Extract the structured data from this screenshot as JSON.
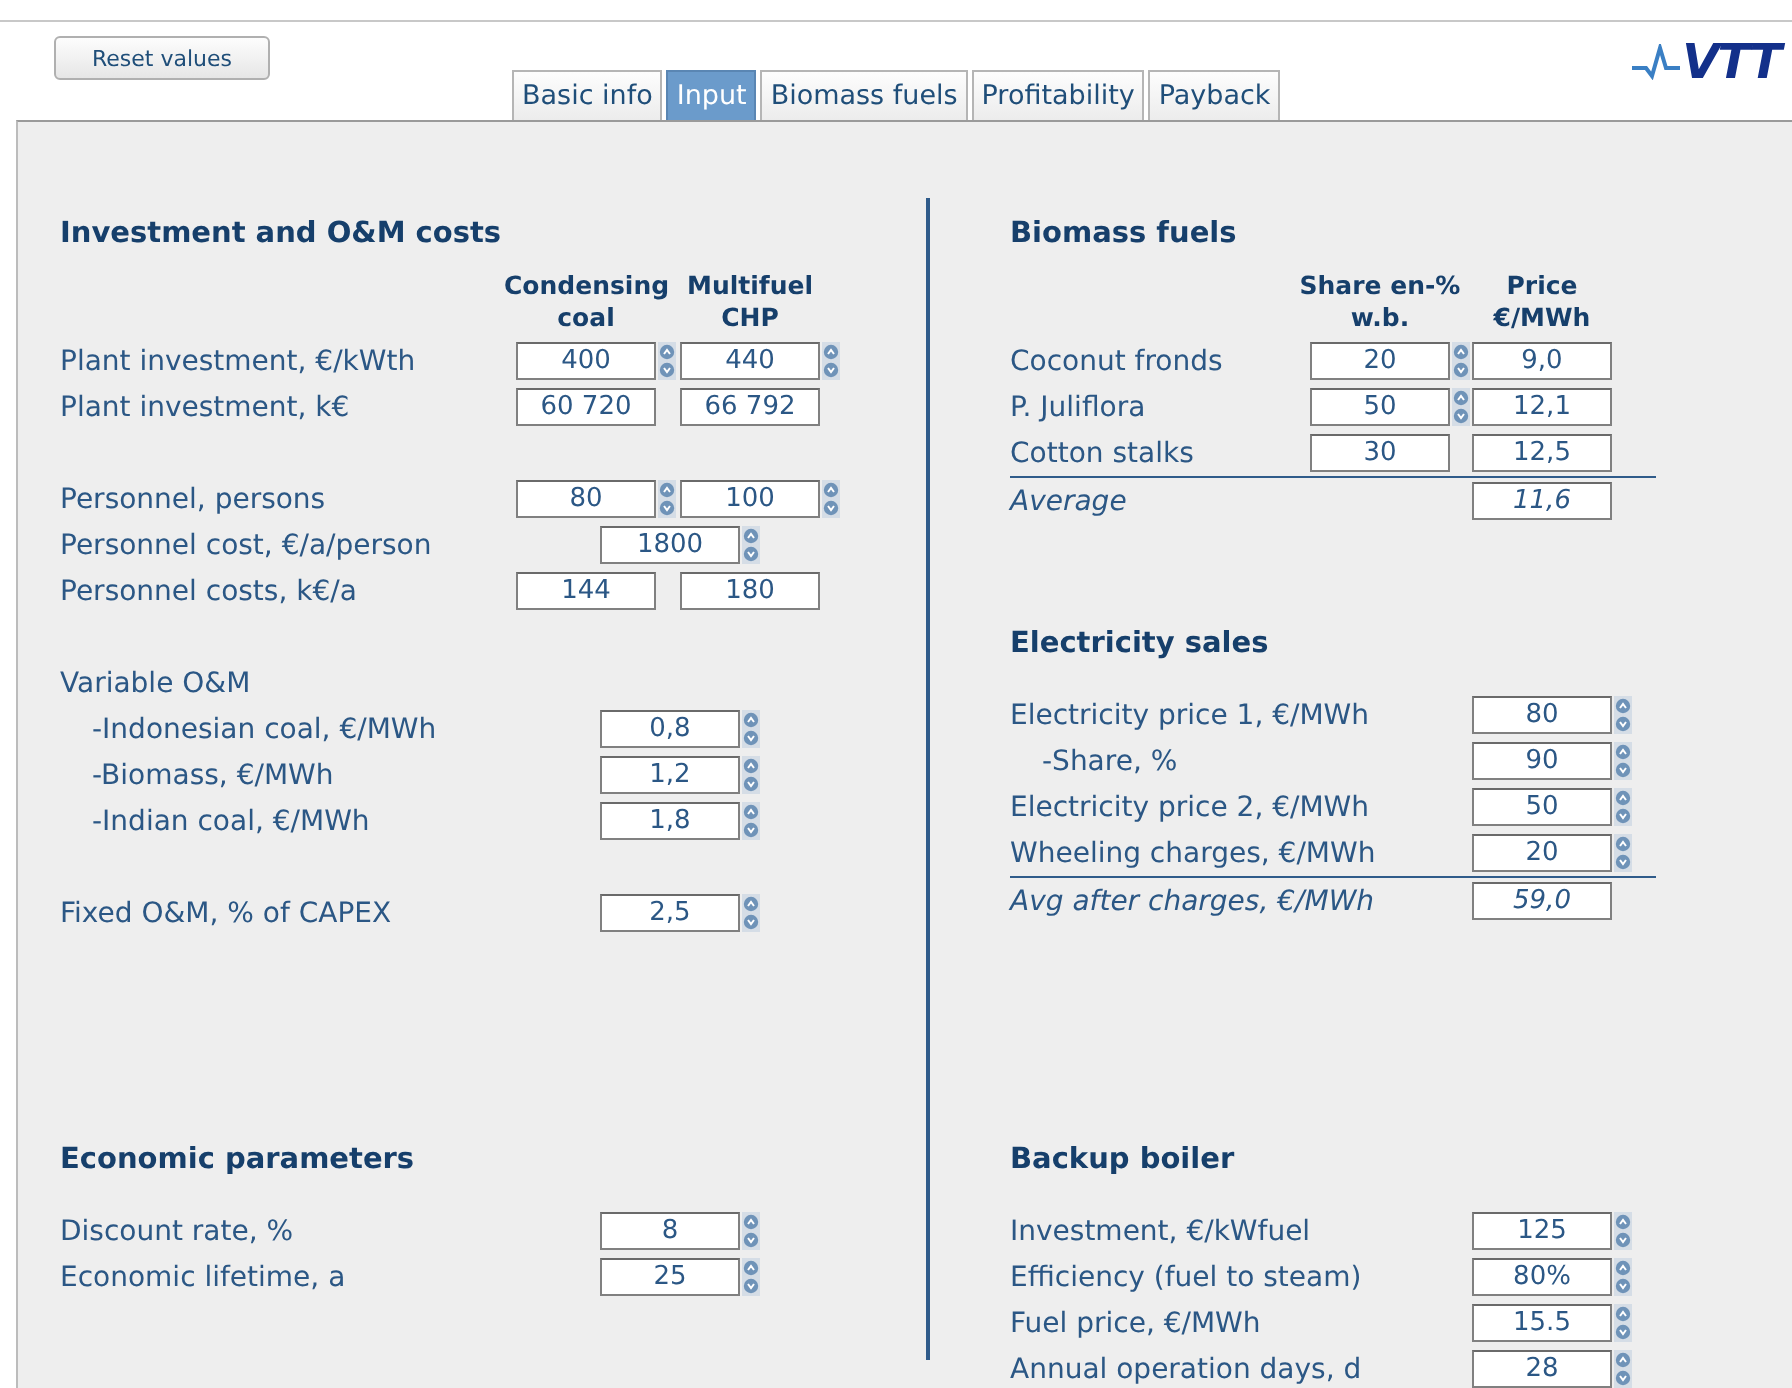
{
  "reset_button": "Reset values",
  "tabs": [
    {
      "label": "Basic info",
      "selected": false
    },
    {
      "label": "Input",
      "selected": true
    },
    {
      "label": "Biomass fuels",
      "selected": false
    },
    {
      "label": "Profitability",
      "selected": false
    },
    {
      "label": "Payback",
      "selected": false
    }
  ],
  "logo": "VTT",
  "upper": {
    "left": [
      {
        "title": "Investment and O&M costs",
        "columns": [
          "Condensing coal",
          "Multifuel CHP"
        ],
        "groups": [
          [
            {
              "label": "Plant investment, €/kWth",
              "kind": "input",
              "values": [
                {
                  "value": "400",
                  "spinner": true
                },
                {
                  "value": "440",
                  "spinner": true
                }
              ]
            },
            {
              "label": "Plant investment, k€",
              "kind": "input",
              "values": [
                {
                  "value": "60 720",
                  "spinner": false
                },
                {
                  "value": "66 792",
                  "spinner": false
                }
              ]
            }
          ],
          [
            {
              "label": "Personnel, persons",
              "kind": "input",
              "values": [
                {
                  "value": "80",
                  "spinner": true
                },
                {
                  "value": "100",
                  "spinner": true
                }
              ]
            },
            {
              "label": "Personnel cost, €/a/person",
              "kind": "input",
              "values": [
                {
                  "value": "1800",
                  "spinner": true
                }
              ]
            },
            {
              "label": "Personnel costs, k€/a",
              "kind": "input",
              "values": [
                {
                  "value": "144",
                  "spinner": false
                },
                {
                  "value": "180",
                  "spinner": false
                }
              ]
            }
          ],
          [
            {
              "label": "Variable O&M",
              "kind": "input",
              "children": [
                {
                  "label": "-Indonesian coal, €/MWh",
                  "kind": "input",
                  "values": [
                    {
                      "value": "0,8",
                      "spinner": true
                    }
                  ]
                },
                {
                  "label": "-Biomass, €/MWh",
                  "kind": "input",
                  "values": [
                    {
                      "value": "1,2",
                      "spinner": true
                    }
                  ]
                },
                {
                  "label": "-Indian coal, €/MWh",
                  "kind": "input",
                  "values": [
                    {
                      "value": "1,8",
                      "spinner": true
                    }
                  ]
                }
              ]
            }
          ],
          [
            {
              "label": "Fixed O&M, % of CAPEX",
              "kind": "input",
              "values": [
                {
                  "value": "2,5",
                  "spinner": true
                }
              ]
            }
          ]
        ]
      }
    ],
    "right": [
      {
        "title": "Biomass fuels",
        "columns": [
          "Share en-% w.b.",
          "Price €/MWh"
        ],
        "groups": [
          [
            {
              "label": "Coconut fronds",
              "kind": "input",
              "values": [
                {
                  "value": "20",
                  "spinner": true
                },
                {
                  "value": "9,0",
                  "spinner": false
                }
              ]
            },
            {
              "label": "P. Juliflora",
              "kind": "input",
              "values": [
                {
                  "value": "50",
                  "spinner": true
                },
                {
                  "value": "12,1",
                  "spinner": false
                }
              ]
            },
            {
              "label": "Cotton stalks",
              "kind": "input",
              "values": [
                {
                  "value": "30",
                  "spinner": false
                },
                {
                  "value": "12,5",
                  "spinner": false
                }
              ]
            },
            {
              "label": "Average",
              "kind": "total",
              "values": [
                {
                  "value": "11,6",
                  "spinner": false
                }
              ]
            }
          ]
        ]
      },
      {
        "title": "Electricity sales",
        "groups": [
          [
            {
              "label": "Electricity price 1, €/MWh",
              "kind": "input",
              "values": [
                {
                  "value": "80",
                  "spinner": true
                }
              ],
              "children": [
                {
                  "label": "-Share, %",
                  "kind": "input",
                  "values": [
                    {
                      "value": "90",
                      "spinner": true
                    }
                  ]
                }
              ]
            },
            {
              "label": "Electricity price 2, €/MWh",
              "kind": "input",
              "values": [
                {
                  "value": "50",
                  "spinner": true
                }
              ]
            },
            {
              "label": "Wheeling charges, €/MWh",
              "kind": "input",
              "values": [
                {
                  "value": "20",
                  "spinner": true
                }
              ]
            },
            {
              "label": "Avg after charges, €/MWh",
              "kind": "total",
              "values": [
                {
                  "value": "59,0",
                  "spinner": false
                }
              ]
            }
          ]
        ]
      }
    ]
  },
  "lower": {
    "left": [
      {
        "title": "Economic parameters",
        "groups": [
          [
            {
              "label": "Discount rate, %",
              "kind": "input",
              "values": [
                {
                  "value": "8",
                  "spinner": true
                }
              ]
            },
            {
              "label": "Economic lifetime, a",
              "kind": "input",
              "values": [
                {
                  "value": "25",
                  "spinner": true
                }
              ]
            }
          ]
        ]
      }
    ],
    "right": [
      {
        "title": "Backup boiler",
        "groups": [
          [
            {
              "label": "Investment, €/kWfuel",
              "kind": "input",
              "values": [
                {
                  "value": "125",
                  "spinner": true
                }
              ]
            },
            {
              "label": "Efficiency (fuel to steam)",
              "kind": "input",
              "values": [
                {
                  "value": "80%",
                  "spinner": true
                }
              ]
            },
            {
              "label": "Fuel price, €/MWh",
              "kind": "input",
              "values": [
                {
                  "value": "15.5",
                  "spinner": true
                }
              ]
            },
            {
              "label": "Annual operation days, d",
              "kind": "input",
              "values": [
                {
                  "value": "28",
                  "spinner": true
                }
              ]
            }
          ]
        ]
      }
    ]
  }
}
